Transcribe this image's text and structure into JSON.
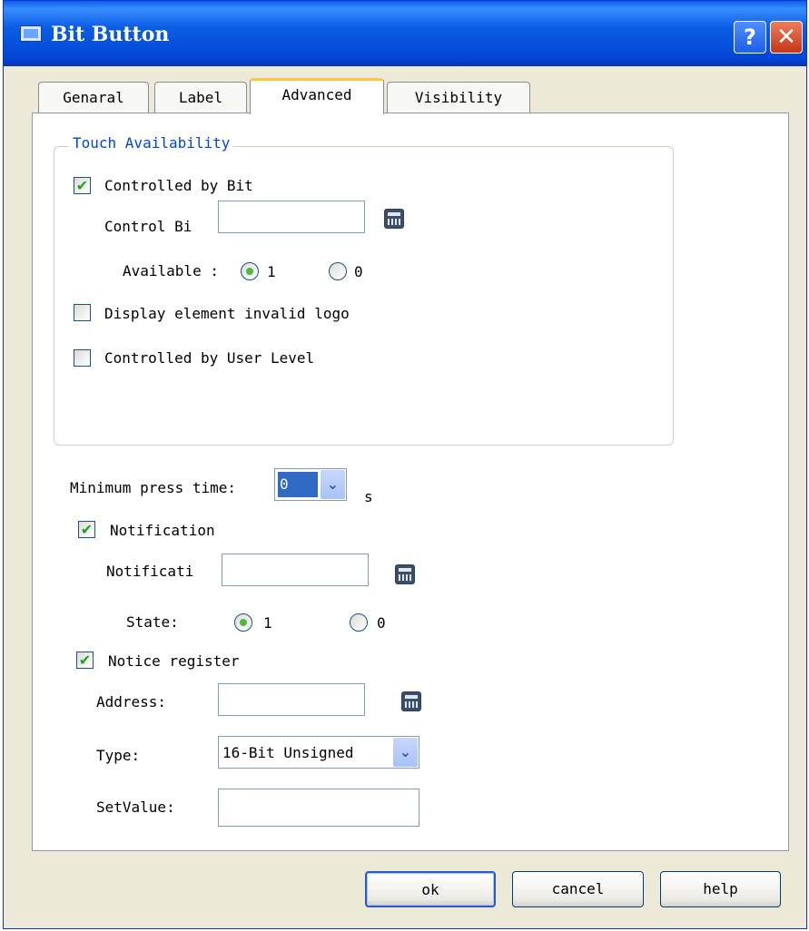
{
  "window": {
    "title": "Bit Button",
    "help_glyph": "?",
    "close_glyph": "✕"
  },
  "tabs": [
    {
      "label": "Genaral",
      "active": false
    },
    {
      "label": "Label",
      "active": false
    },
    {
      "label": "Advanced",
      "active": true
    },
    {
      "label": "Visibility",
      "active": false
    }
  ],
  "touch_group": {
    "legend": "Touch Availability",
    "controlled_by_bit": {
      "label": "Controlled by Bit",
      "checked": true
    },
    "control_bit": {
      "label": "Control Bi",
      "value": ""
    },
    "available": {
      "label": "Available :",
      "option1": "1",
      "option0": "0",
      "selected": "1"
    },
    "display_invalid_logo": {
      "label": "Display element invalid logo",
      "checked": false
    },
    "controlled_by_user_level": {
      "label": "Controlled by User Level",
      "checked": false
    }
  },
  "min_press": {
    "label": "Minimum press time:",
    "value": "0",
    "unit": "s"
  },
  "notification": {
    "label": "Notification",
    "checked": true,
    "address_label": "Notificati",
    "address_value": "",
    "state_label": "State:",
    "option1": "1",
    "option0": "0",
    "selected": "1"
  },
  "notice_register": {
    "label": "Notice register",
    "checked": true,
    "address_label": "Address:",
    "address_value": "",
    "type_label": "Type:",
    "type_value": "16-Bit Unsigned",
    "setvalue_label": "SetValue:",
    "setvalue_value": ""
  },
  "buttons": {
    "ok": "ok",
    "cancel": "cancel",
    "help": "help"
  },
  "icons": {
    "checkmark": "✔",
    "dropdown": "⌄"
  },
  "colors": {
    "title_bar": "#0a5fe8",
    "group_legend": "#0046d5",
    "check_green": "#21a121",
    "tab_accent": "#ffc53d"
  }
}
